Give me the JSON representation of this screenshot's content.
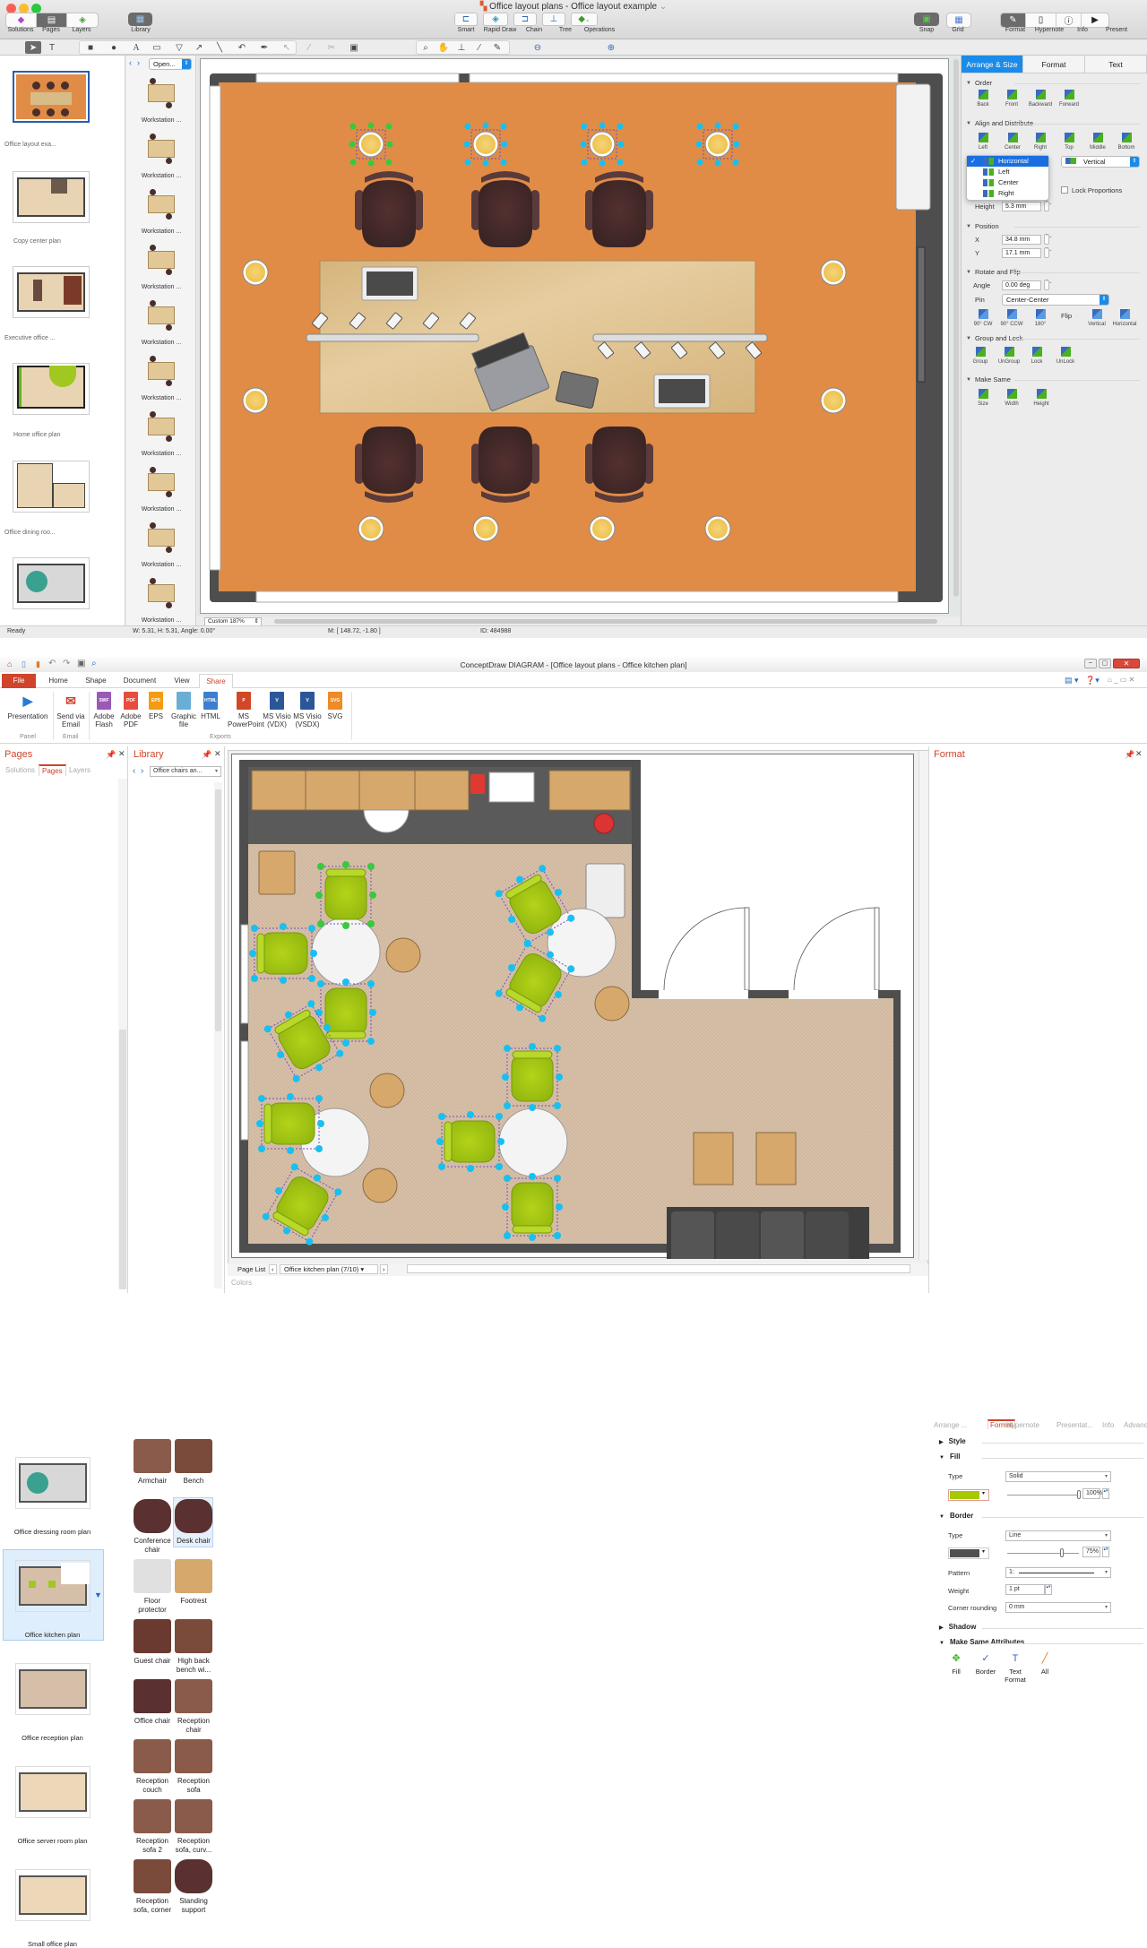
{
  "mac": {
    "window_title": "Office layout plans - Office layout example",
    "toolbar_left": [
      {
        "label": "Solutions",
        "icon": "solutions-icon"
      },
      {
        "label": "Pages",
        "icon": "pages-icon"
      },
      {
        "label": "Layers",
        "icon": "layers-icon"
      }
    ],
    "library_label": "Library",
    "toolbar_center": [
      {
        "label": "Smart",
        "icon": "smart-connector-icon"
      },
      {
        "label": "Rapid Draw",
        "icon": "rapid-draw-icon"
      },
      {
        "label": "Chain",
        "icon": "chain-icon"
      },
      {
        "label": "Tree",
        "icon": "tree-icon"
      },
      {
        "label": "Operations",
        "icon": "operations-icon"
      }
    ],
    "toolbar_right": [
      {
        "label": "Snap",
        "icon": "snap-icon"
      },
      {
        "label": "Grid",
        "icon": "grid-icon"
      },
      {
        "label": "Format",
        "icon": "format-icon"
      },
      {
        "label": "Hypernote",
        "icon": "hypernote-icon"
      },
      {
        "label": "Info",
        "icon": "info-icon"
      },
      {
        "label": "Present",
        "icon": "present-icon"
      }
    ],
    "pages": [
      {
        "label": "Office layout exa...",
        "selected": true
      },
      {
        "label": "Copy center plan"
      },
      {
        "label": "Executive office ..."
      },
      {
        "label": "Home office plan"
      },
      {
        "label": "Office dining roo..."
      },
      {
        "label": ""
      }
    ],
    "library": {
      "dropdown": "Open...",
      "items": [
        "Workstation ...",
        "Workstation ...",
        "Workstation ...",
        "Workstation ...",
        "Workstation ...",
        "Workstation ...",
        "Workstation ...",
        "Workstation ...",
        "Workstation ...",
        "Workstation ..."
      ]
    },
    "zoom_select": "Custom 187%",
    "inspector": {
      "tabs": [
        "Arrange & Size",
        "Format",
        "Text"
      ],
      "active_tab": "Arrange & Size",
      "order": {
        "title": "Order",
        "buttons": [
          "Back",
          "Front",
          "Backward",
          "Forward"
        ]
      },
      "align": {
        "title": "Align and Distribute",
        "buttons": [
          "Left",
          "Center",
          "Right",
          "Top",
          "Middle",
          "Bottom"
        ]
      },
      "distribute_h": {
        "selected": "Horizontal",
        "options": [
          "Horizontal",
          "Left",
          "Center",
          "Right"
        ]
      },
      "distribute_v": "Vertical",
      "lock_proportions": "Lock Proportions",
      "height_label": "Height",
      "height_value": "5.3 mm",
      "position": {
        "title": "Position",
        "x_label": "X",
        "x": "34.8 mm",
        "y_label": "Y",
        "y": "17.1 mm"
      },
      "rotate": {
        "title": "Rotate and Flip",
        "angle_label": "Angle",
        "angle": "0.00 deg",
        "pin_label": "Pin",
        "pin": "Center-Center",
        "buttons": [
          "90° CW",
          "90° CCW",
          "180°"
        ],
        "flip_label": "Flip",
        "flip_buttons": [
          "Vertical",
          "Horizontal"
        ]
      },
      "group": {
        "title": "Group and Lock",
        "buttons": [
          "Group",
          "UnGroup",
          "Lock",
          "UnLock"
        ]
      },
      "make_same": {
        "title": "Make Same",
        "buttons": [
          "Size",
          "Width",
          "Height"
        ]
      }
    },
    "status": {
      "state": "Ready",
      "dims": "W: 5.31,  H: 5.31,  Angle: 0.00°",
      "mouse": "M: [ 148.72, -1.80 ]",
      "id": "ID: 484988"
    }
  },
  "win": {
    "title": "ConceptDraw DIAGRAM - [Office layout plans - Office kitchen plan]",
    "ribbon_tabs": [
      "File",
      "Home",
      "Shape",
      "Document",
      "View",
      "Share"
    ],
    "active_ribbon_tab": "Share",
    "ribbon": {
      "panel": {
        "label": "Panel",
        "buttons": [
          {
            "label": "Presentation"
          }
        ]
      },
      "email": {
        "label": "Email",
        "buttons": [
          {
            "label": "Send via Email"
          }
        ]
      },
      "exports": {
        "label": "Exports",
        "buttons": [
          {
            "label": "Adobe Flash",
            "badge": "SWF",
            "color": "#9b59b6"
          },
          {
            "label": "Adobe PDF",
            "badge": "PDF",
            "color": "#e74c3c"
          },
          {
            "label": "EPS",
            "badge": "EPS",
            "color": "#f39c12"
          },
          {
            "label": "Graphic file",
            "badge": "",
            "color": "#6aaed6"
          },
          {
            "label": "HTML",
            "badge": "HTML",
            "color": "#3c7fd0"
          },
          {
            "label": "MS PowerPoint",
            "badge": "P",
            "color": "#d24726"
          },
          {
            "label": "MS Visio (VDX)",
            "badge": "V",
            "color": "#2b579a"
          },
          {
            "label": "MS Visio (VSDX)",
            "badge": "V",
            "color": "#2b579a"
          },
          {
            "label": "SVG",
            "badge": "SVG",
            "color": "#f08a24"
          }
        ]
      }
    },
    "pages_panel": {
      "title": "Pages",
      "tabs": [
        "Solutions",
        "Pages",
        "Layers"
      ],
      "active_tab": "Pages",
      "items": [
        {
          "label": "Office dressing room plan"
        },
        {
          "label": "Office kitchen plan",
          "selected": true
        },
        {
          "label": "Office reception plan"
        },
        {
          "label": "Office server room plan"
        },
        {
          "label": "Small office plan"
        }
      ]
    },
    "library_panel": {
      "title": "Library",
      "dropdown": "Office chairs an...",
      "items": [
        "Armchair",
        "Bench",
        "Conference chair",
        "Desk chair",
        "Floor protector",
        "Footrest",
        "Guest chair",
        "High back bench wi...",
        "Office chair",
        "Reception chair",
        "Reception couch",
        "Reception sofa",
        "Reception sofa 2",
        "Reception sofa, curv...",
        "Reception sofa, corner",
        "Standing support"
      ]
    },
    "page_list": {
      "label": "Page List",
      "current": "Office kitchen plan (7/10)"
    },
    "colors_label": "Colors",
    "format_panel": {
      "title": "Format",
      "tabs": [
        "Arrange ...",
        "Format",
        "Hypernote",
        "Presentat...",
        "Info",
        "Advanced"
      ],
      "active_tab": "Format",
      "style": "Style",
      "fill": {
        "title": "Fill",
        "type_label": "Type",
        "type": "Solid",
        "color": "#a8c800",
        "opacity": "100%",
        "opacity_value": 100
      },
      "border": {
        "title": "Border",
        "type_label": "Type",
        "type": "Line",
        "color": "#505050",
        "opacity": "75%",
        "opacity_value": 75,
        "pattern_label": "Pattern",
        "pattern": "1:",
        "weight_label": "Weight",
        "weight": "1 pt",
        "corner_label": "Corner rounding",
        "corner": "0 mm"
      },
      "shadow": "Shadow",
      "make_same": {
        "title": "Make Same Attributes",
        "buttons": [
          "Fill",
          "Border",
          "Text Format",
          "All"
        ]
      }
    }
  }
}
